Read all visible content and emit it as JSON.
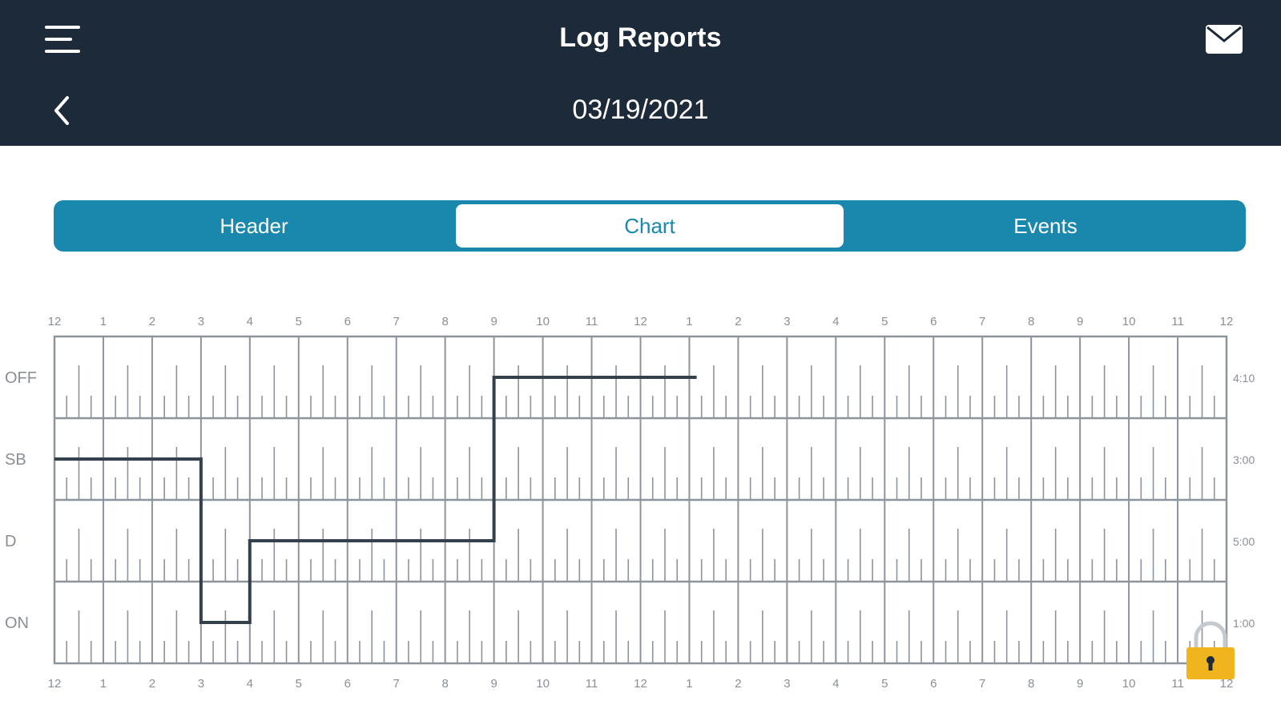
{
  "header": {
    "title": "Log Reports",
    "date": "03/19/2021",
    "menu_icon": "hamburger-menu-icon",
    "mail_icon": "mail-icon",
    "back_icon": "chevron-left-icon"
  },
  "tabs": [
    {
      "label": "Header",
      "active": false
    },
    {
      "label": "Chart",
      "active": true
    },
    {
      "label": "Events",
      "active": false
    }
  ],
  "colors": {
    "topbar": "#1d2a39",
    "tab_bar": "#1a88ad",
    "grid": "#8d949b",
    "status_line": "#34404e",
    "lock": "#f0b41e"
  },
  "chart_data": {
    "type": "line",
    "x_tick_labels": [
      "12",
      "1",
      "2",
      "3",
      "4",
      "5",
      "6",
      "7",
      "8",
      "9",
      "10",
      "11",
      "12",
      "1",
      "2",
      "3",
      "4",
      "5",
      "6",
      "7",
      "8",
      "9",
      "10",
      "11",
      "12"
    ],
    "rows": [
      "OFF",
      "SB",
      "D",
      "ON"
    ],
    "row_totals": [
      "4:10",
      "3:00",
      "5:00",
      "1:00"
    ],
    "series": [
      {
        "points": [
          {
            "hour": 0,
            "status": "SB"
          },
          {
            "hour": 3,
            "status": "SB"
          },
          {
            "hour": 3,
            "status": "ON"
          },
          {
            "hour": 4,
            "status": "ON"
          },
          {
            "hour": 4,
            "status": "D"
          },
          {
            "hour": 9,
            "status": "D"
          },
          {
            "hour": 9,
            "status": "OFF"
          },
          {
            "hour": 13.15,
            "status": "OFF"
          }
        ]
      }
    ]
  },
  "lock_icon": "padlock-icon"
}
